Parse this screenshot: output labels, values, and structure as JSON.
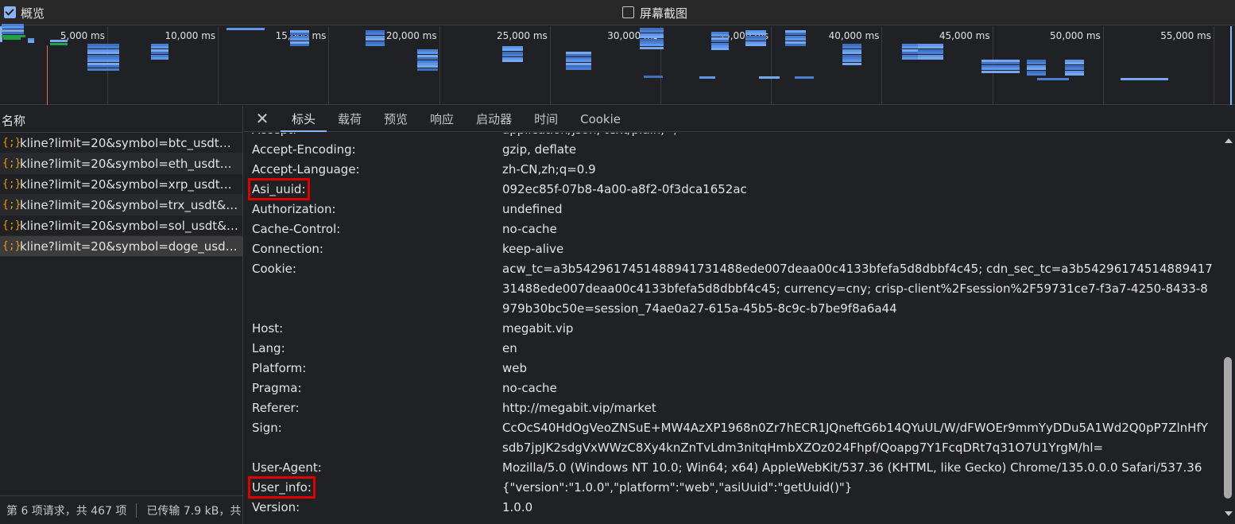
{
  "toolbar": {
    "overview_label": "概览",
    "overview_checked": true,
    "screenshot_label": "屏幕截图",
    "screenshot_checked": false
  },
  "timeline": {
    "ticks": [
      "5,000 ms",
      "10,000 ms",
      "15,000 ms",
      "20,000 ms",
      "25,000 ms",
      "30,000 ms",
      "35,000 ms",
      "40,000 ms",
      "45,000 ms",
      "50,000 ms",
      "55,000 ms"
    ]
  },
  "request_list": {
    "header": "名称",
    "items": [
      {
        "icon": "{;}",
        "name": "kline?limit=20&symbol=btc_usdt&i..."
      },
      {
        "icon": "{;}",
        "name": "kline?limit=20&symbol=eth_usdt&i..."
      },
      {
        "icon": "{;}",
        "name": "kline?limit=20&symbol=xrp_usdt&i..."
      },
      {
        "icon": "{;}",
        "name": "kline?limit=20&symbol=trx_usdt&in..."
      },
      {
        "icon": "{;}",
        "name": "kline?limit=20&symbol=sol_usdt&in..."
      },
      {
        "icon": "{;}",
        "name": "kline?limit=20&symbol=doge_usdt..."
      }
    ],
    "status_requests": "第 6 项请求，共 467 项",
    "status_transferred": "已传输 7.9 kB，共"
  },
  "detail_tabs": [
    "标头",
    "载荷",
    "预览",
    "响应",
    "启动器",
    "时间",
    "Cookie"
  ],
  "headers": [
    {
      "name": "Accept:",
      "value": "application/json, text/plain, */*"
    },
    {
      "name": "Accept-Encoding:",
      "value": "gzip, deflate"
    },
    {
      "name": "Accept-Language:",
      "value": "zh-CN,zh;q=0.9"
    },
    {
      "name": "Asi_uuid:",
      "value": "092ec85f-07b8-4a00-a8f2-0f3dca1652ac",
      "highlight": true
    },
    {
      "name": "Authorization:",
      "value": "undefined"
    },
    {
      "name": "Cache-Control:",
      "value": "no-cache"
    },
    {
      "name": "Connection:",
      "value": "keep-alive"
    },
    {
      "name": "Cookie:",
      "value": "acw_tc=a3b5429617451488941731488ede007deaa00c4133bfefa5d8dbbf4c45; cdn_sec_tc=a3b5429617451488941731488ede007deaa00c4133bfefa5d8dbbf4c45; currency=cny; crisp-client%2Fsession%2F59731ce7-f3a7-4250-8433-8979b30bc50e=session_74ae0a27-615a-45b5-8c9c-b7be9f8a6a44"
    },
    {
      "name": "Host:",
      "value": "megabit.vip"
    },
    {
      "name": "Lang:",
      "value": "en"
    },
    {
      "name": "Platform:",
      "value": "web"
    },
    {
      "name": "Pragma:",
      "value": "no-cache"
    },
    {
      "name": "Referer:",
      "value": "http://megabit.vip/market"
    },
    {
      "name": "Sign:",
      "value": "CcOcS40HdOgVeoZNSuE+MW4AzXP1968n0Zr7hECR1JQneftG6b14QYuUL/W/dFWOEr9mmYyDDu5A1Wd2Q0pP7ZlnHfYsdb7jpJK2sdgVxWWzC8Xy4knZnTvLdm3nitqHmbXZOz024Fhpf/Qoapg7Y1FcqDRt7q31O7U1YrgM/hl="
    },
    {
      "name": "User-Agent:",
      "value": "Mozilla/5.0 (Windows NT 10.0; Win64; x64) AppleWebKit/537.36 (KHTML, like Gecko) Chrome/135.0.0.0 Safari/537.36"
    },
    {
      "name": "User_info:",
      "value": "{\"version\":\"1.0.0\",\"platform\":\"web\",\"asiUuid\":\"getUuid()\"}",
      "highlight": true
    },
    {
      "name": "Version:",
      "value": "1.0.0"
    }
  ],
  "colors": {
    "accent": "#8ab4f8",
    "highlight_box": "#e00000",
    "json_icon": "#f29900"
  }
}
